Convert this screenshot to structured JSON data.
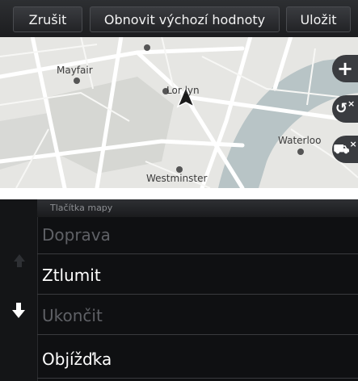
{
  "toolbar": {
    "cancel_label": "Zrušit",
    "reset_label": "Obnovit výchozí hodnoty",
    "save_label": "Uložit"
  },
  "map": {
    "labels": {
      "mayfair": "Mayfair",
      "london": "Lor  lyn",
      "westminster": "Westminster",
      "waterloo": "Waterloo"
    },
    "side_buttons": [
      "zoom-in-icon",
      "detour-icon-removed",
      "traffic-icon-removed"
    ],
    "colors": {
      "river": "#b8c4c6",
      "roads": "#ffffff",
      "land": "#e6e6e3",
      "park": "#d8d9d6"
    }
  },
  "list": {
    "header": "Tlačítka mapy",
    "items": [
      {
        "label": "Doprava",
        "enabled": false
      },
      {
        "label": "Ztlumit",
        "enabled": true
      },
      {
        "label": "Ukončit",
        "enabled": false
      },
      {
        "label": "Objížďka",
        "enabled": true
      }
    ]
  }
}
